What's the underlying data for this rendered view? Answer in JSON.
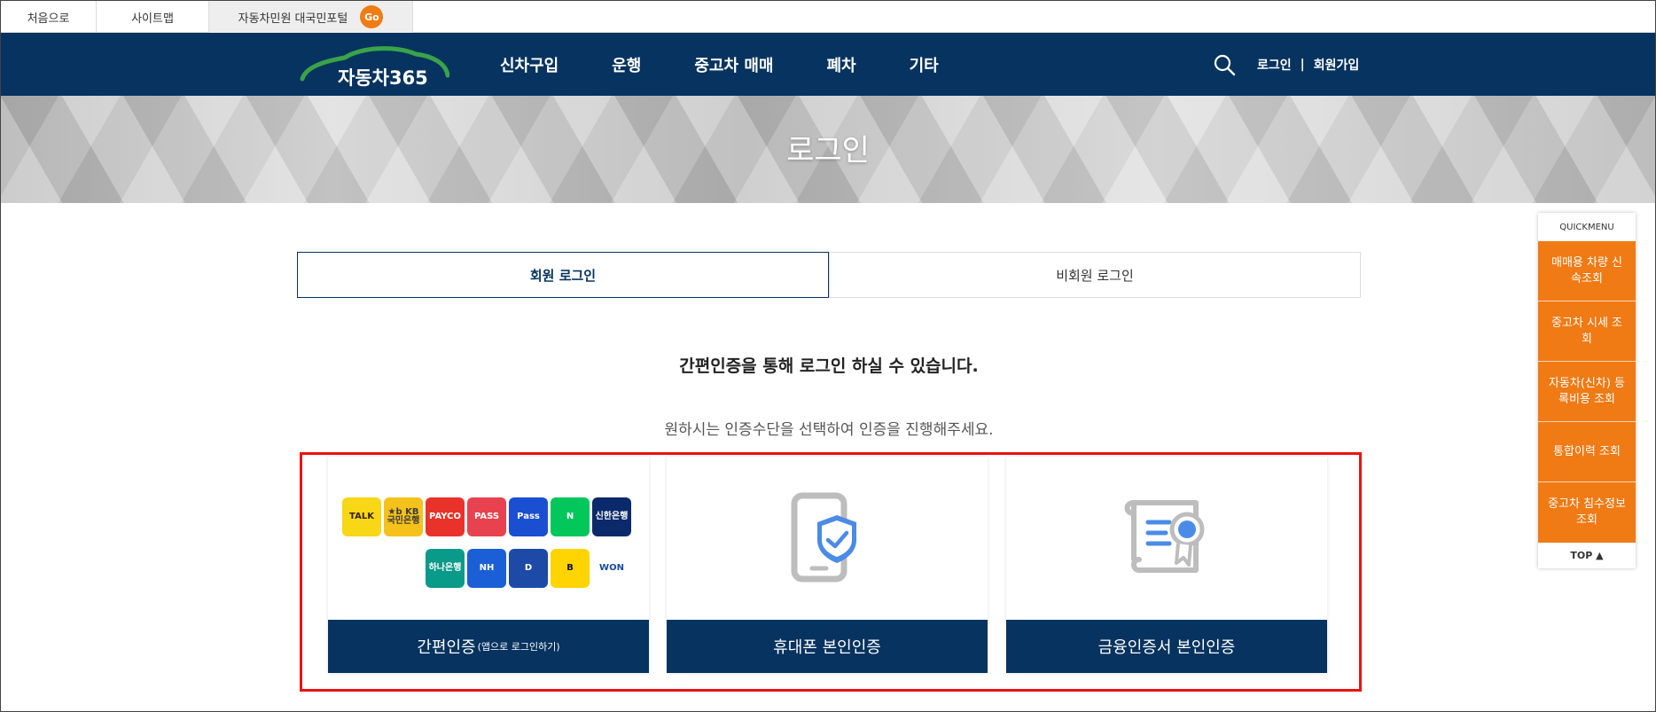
{
  "topbar": {
    "home": "처음으로",
    "sitemap": "사이트맵",
    "portal": "자동차민원 대국민포털",
    "go": "Go"
  },
  "header": {
    "logo_text": "자동차365",
    "nav": [
      "신차구입",
      "운행",
      "중고차 매매",
      "폐차",
      "기타"
    ],
    "login": "로그인",
    "separator": "|",
    "signup": "회원가입"
  },
  "banner": {
    "title": "로그인"
  },
  "tabs": {
    "member": "회원 로그인",
    "guest": "비회원 로그인"
  },
  "content": {
    "headline": "간편인증을 통해 로그인 하실 수 있습니다.",
    "subline": "원하시는 인증수단을 선택하여 인증을 진행해주세요."
  },
  "cards": {
    "simple_label": "간편인증",
    "simple_sub": "(앱으로 로그인하기)",
    "phone_label": "휴대폰 본인인증",
    "cert_label": "금융인증서 본인인증"
  },
  "apps": [
    {
      "name": "kakao-talk",
      "text": "TALK",
      "bg": "#f7d716",
      "fg": "#3b1e1e"
    },
    {
      "name": "kb",
      "text": "★b KB국민은행",
      "bg": "#f5c11b",
      "fg": "#3a3a3a"
    },
    {
      "name": "payco",
      "text": "PAYCO",
      "bg": "#e9332a",
      "fg": "#ffffff"
    },
    {
      "name": "pass",
      "text": "PASS",
      "bg": "#e8424e",
      "fg": "#ffffff"
    },
    {
      "name": "samsung-pass",
      "text": "Pass",
      "bg": "#1b4fd1",
      "fg": "#ffffff"
    },
    {
      "name": "naver",
      "text": "N",
      "bg": "#03c75a",
      "fg": "#ffffff"
    },
    {
      "name": "shinhan",
      "text": "신한은행",
      "bg": "#0b2a6b",
      "fg": "#ffffff"
    },
    {
      "name": "toss",
      "text": "",
      "bg": "#ffffff",
      "fg": "#1b64f2"
    },
    {
      "name": "heart",
      "text": "",
      "bg": "#ffffff",
      "fg": "#26b36b"
    },
    {
      "name": "hana",
      "text": "하나은행",
      "bg": "#0a9a8a",
      "fg": "#ffffff"
    },
    {
      "name": "nh",
      "text": "NH",
      "bg": "#1b5fd6",
      "fg": "#ffffff"
    },
    {
      "name": "d-shield",
      "text": "D",
      "bg": "#1c4aa6",
      "fg": "#ffffff"
    },
    {
      "name": "b-app",
      "text": "B",
      "bg": "#ffd400",
      "fg": "#111111"
    },
    {
      "name": "won",
      "text": "WON",
      "bg": "#ffffff",
      "fg": "#1a4aa1"
    }
  ],
  "quick": {
    "title": "QUICKMENU",
    "items": [
      "매매용 차량 신속조회",
      "중고차 시세 조회",
      "자동차(신차) 등록비용 조회",
      "통합이력 조회",
      "중고차 침수정보 조회"
    ],
    "top": "TOP ▲"
  },
  "colors": {
    "navy": "#06335f",
    "orange": "#f07a14",
    "highlight": "#ee1111"
  }
}
